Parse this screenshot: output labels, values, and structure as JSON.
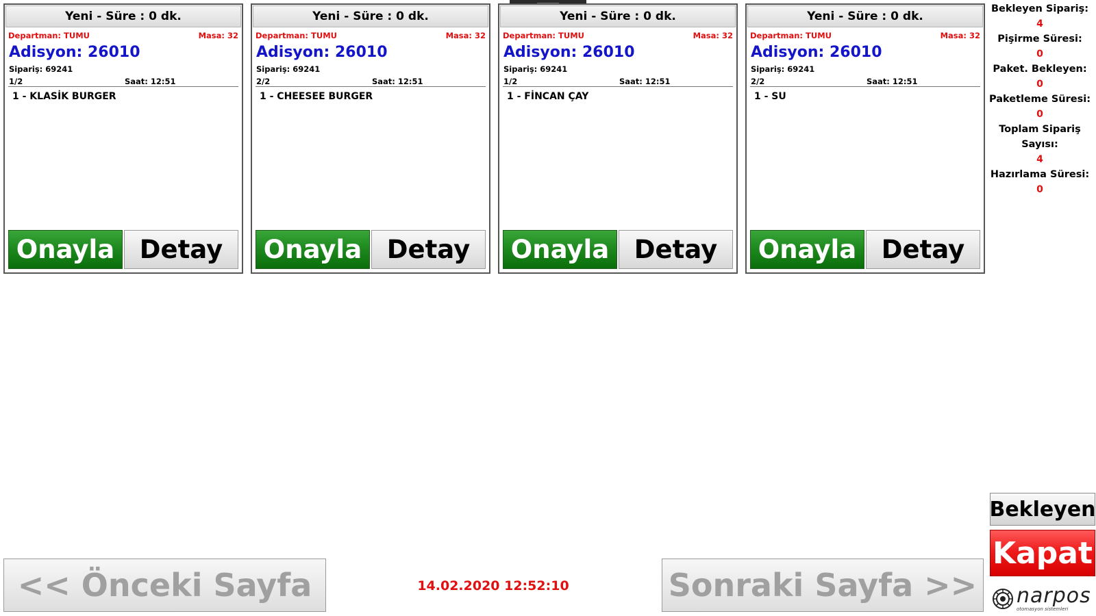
{
  "orders": [
    {
      "header": "Yeni - Süre : 0 dk.",
      "department": "Departman: TUMU",
      "table": "Masa: 32",
      "adisyon": "Adisyon: 26010",
      "siparis": "Sipariş: 69241",
      "page": "1/2",
      "saat": "Saat: 12:51",
      "item": "1 - KLASİK BURGER",
      "approve_label": "Onayla",
      "detail_label": "Detay"
    },
    {
      "header": "Yeni - Süre : 0 dk.",
      "department": "Departman: TUMU",
      "table": "Masa: 32",
      "adisyon": "Adisyon: 26010",
      "siparis": "Sipariş: 69241",
      "page": "2/2",
      "saat": "Saat: 12:51",
      "item": "1 - CHEESEE BURGER",
      "approve_label": "Onayla",
      "detail_label": "Detay"
    },
    {
      "header": "Yeni - Süre : 0 dk.",
      "department": "Departman: TUMU",
      "table": "Masa: 32",
      "adisyon": "Adisyon: 26010",
      "siparis": "Sipariş: 69241",
      "page": "1/2",
      "saat": "Saat: 12:51",
      "item": "1 - FİNCAN ÇAY",
      "approve_label": "Onayla",
      "detail_label": "Detay"
    },
    {
      "header": "Yeni - Süre : 0 dk.",
      "department": "Departman: TUMU",
      "table": "Masa: 32",
      "adisyon": "Adisyon: 26010",
      "siparis": "Sipariş: 69241",
      "page": "2/2",
      "saat": "Saat: 12:51",
      "item": "1 - SU",
      "approve_label": "Onayla",
      "detail_label": "Detay"
    }
  ],
  "stats": {
    "bekleyen_siparis_label": "Bekleyen Sipariş:",
    "bekleyen_siparis_value": "4",
    "pisirme_suresi_label": "Pişirme Süresi:",
    "pisirme_suresi_value": "0",
    "paket_bekleyen_label": "Paket. Bekleyen:",
    "paket_bekleyen_value": "0",
    "paketleme_suresi_label": "Paketleme Süresi:",
    "paketleme_suresi_value": "0",
    "toplam_siparis_label_1": "Toplam Sipariş",
    "toplam_siparis_label_2": "Sayısı:",
    "toplam_siparis_value": "4",
    "hazirlama_suresi_label": "Hazırlama Süresi:",
    "hazirlama_suresi_value": "0"
  },
  "actions": {
    "bekleyen_label": "Bekleyen",
    "kapat_label": "Kapat"
  },
  "navigation": {
    "prev_label": "<< Önceki Sayfa",
    "next_label": "Sonraki Sayfa >>"
  },
  "datetime": "14.02.2020 12:52:10",
  "logo": {
    "brand": "narpos",
    "tagline": "otomasyon sistemleri"
  },
  "colors": {
    "accent_blue": "#1414c8",
    "alert_red": "#e01010",
    "approve_green": "#1f8a1f",
    "close_red": "#ee1c1c"
  }
}
